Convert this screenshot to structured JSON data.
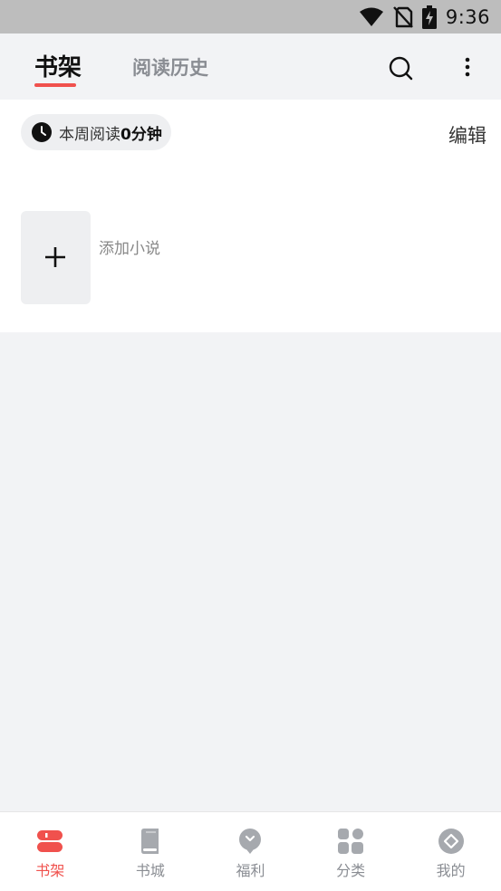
{
  "status_bar": {
    "time": "9:36",
    "icons": [
      "wifi-icon",
      "no-sim-icon",
      "battery-charging-icon"
    ]
  },
  "header": {
    "tabs": [
      {
        "label": "书架",
        "active": true
      },
      {
        "label": "阅读历史",
        "active": false
      }
    ],
    "actions": [
      "search-icon",
      "more-vert-icon"
    ]
  },
  "shelf": {
    "reading_prefix": "本周阅读",
    "reading_value": "0分钟",
    "edit_label": "编辑",
    "add_novel_label": "添加小说"
  },
  "bottom_nav": {
    "items": [
      {
        "label": "书架",
        "icon": "bookshelf-icon",
        "active": true
      },
      {
        "label": "书城",
        "icon": "book-icon",
        "active": false
      },
      {
        "label": "福利",
        "icon": "gift-bulb-icon",
        "active": false
      },
      {
        "label": "分类",
        "icon": "grid-icon",
        "active": false
      },
      {
        "label": "我的",
        "icon": "profile-diamond-icon",
        "active": false
      }
    ]
  },
  "colors": {
    "accent": "#f0514d",
    "inactive": "#8a8d93",
    "background": "#f2f3f5",
    "status_bar": "#bdbdbd"
  }
}
